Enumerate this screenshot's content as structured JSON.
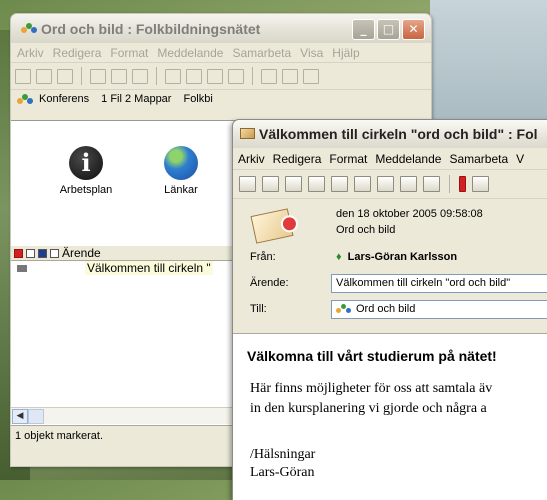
{
  "window_back": {
    "title": "Ord och bild : Folkbildningsnätet",
    "controls": {
      "minimize": "_",
      "maximize": "□",
      "close": "✕"
    },
    "menu": [
      "Arkiv",
      "Redigera",
      "Format",
      "Meddelande",
      "Samarbeta",
      "Visa",
      "Hjälp"
    ],
    "breadcrumb": [
      "Konferens",
      "1 Fil 2 Mappar",
      "Folkbi"
    ],
    "icons": [
      {
        "label": "Arbetsplan",
        "icon": "info-icon"
      },
      {
        "label": "Länkar",
        "icon": "globe-icon"
      }
    ],
    "list_header": "Ärende",
    "list_rows": [
      {
        "subject": "Välkommen till cirkeln \""
      }
    ],
    "status": "1 objekt markerat."
  },
  "window_front": {
    "title": "Välkommen till cirkeln \"ord och bild\" : Fol",
    "menu": [
      "Arkiv",
      "Redigera",
      "Format",
      "Meddelande",
      "Samarbeta",
      "V"
    ],
    "date": "den 18 oktober 2005 09:58:08",
    "subject_top": "Ord och bild",
    "from_label": "Från:",
    "from_value": "Lars-Göran Karlsson",
    "subject_label": "Ärende:",
    "subject_value": "Välkommen till cirkeln \"ord och bild\"",
    "to_label": "Till:",
    "to_value": "Ord och bild",
    "body": {
      "heading": "Välkomna till vårt studierum på nätet!",
      "line1": "Här finns möjligheter för oss att samtala äv",
      "line2": "in den kursplanering vi gjorde och några a",
      "greeting": "/Hälsningar",
      "signature": "Lars-Göran"
    }
  },
  "colors": {
    "accent_red": "#d02222",
    "field_border": "#7f9db9",
    "chrome": "#ece9d8"
  }
}
